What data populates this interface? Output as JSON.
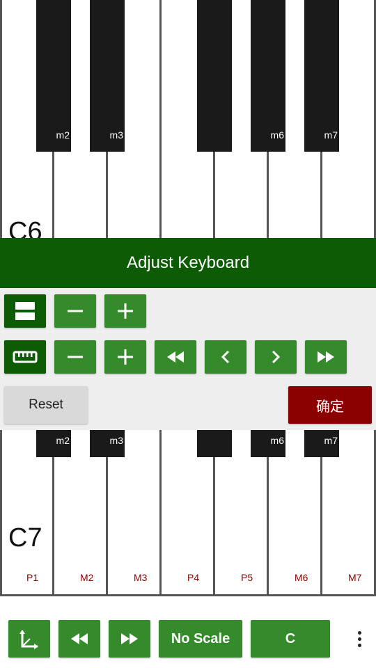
{
  "keyboard_top": {
    "octave_label": "C6",
    "black_key_labels": [
      "m2",
      "m3",
      "",
      "m6",
      "m7"
    ]
  },
  "panel": {
    "title": "Adjust Keyboard",
    "row1_icon": "rows-layout-icon",
    "row2_icon": "ruler-icon",
    "reset_label": "Reset",
    "confirm_label": "确定"
  },
  "keyboard_bottom": {
    "octave_label": "C7",
    "black_key_labels": [
      "m2",
      "m3",
      "",
      "m6",
      "m7"
    ],
    "interval_labels": [
      "P1",
      "M2",
      "M3",
      "P4",
      "P5",
      "M6",
      "M7"
    ]
  },
  "toolbar": {
    "scale_label": "No Scale",
    "key_label": "C",
    "icons": [
      "axes-icon",
      "rewind-icon",
      "fast-forward-icon",
      "more-vert-icon"
    ]
  },
  "colors": {
    "header_green": "#0d5c05",
    "button_green": "#358a2b",
    "confirm_red": "#8b0000",
    "interval_red": "#8b0000",
    "panel_bg": "#eeeeee"
  }
}
